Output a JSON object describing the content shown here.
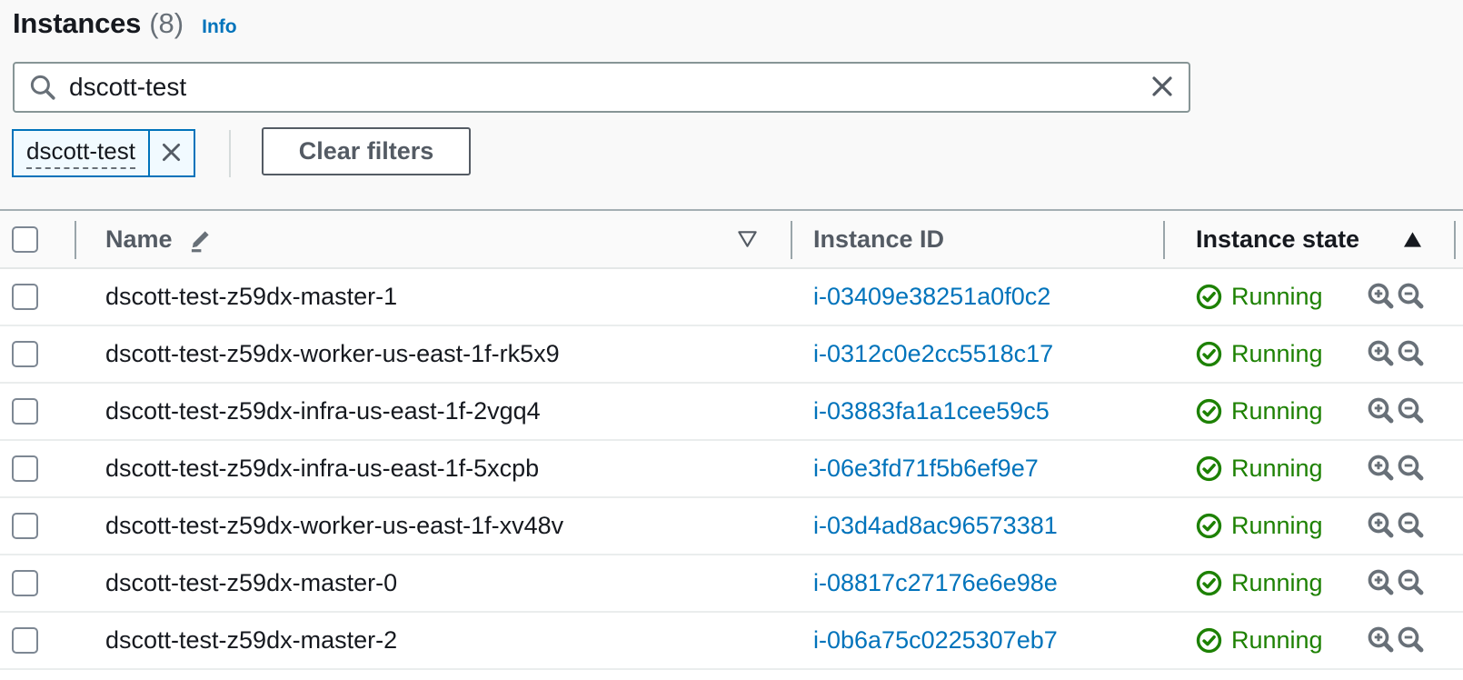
{
  "header": {
    "title": "Instances",
    "count": "(8)",
    "info_label": "Info"
  },
  "search": {
    "value": "dscott-test"
  },
  "filters": {
    "chip_label": "dscott-test",
    "clear_button_label": "Clear filters"
  },
  "table": {
    "columns": {
      "name": "Name",
      "instance_id": "Instance ID",
      "instance_state": "Instance state"
    },
    "sorted_column": "Instance state",
    "sort_direction": "ascending",
    "rows": [
      {
        "name": "dscott-test-z59dx-master-1",
        "instance_id": "i-03409e38251a0f0c2",
        "state": "Running"
      },
      {
        "name": "dscott-test-z59dx-worker-us-east-1f-rk5x9",
        "instance_id": "i-0312c0e2cc5518c17",
        "state": "Running"
      },
      {
        "name": "dscott-test-z59dx-infra-us-east-1f-2vgq4",
        "instance_id": "i-03883fa1a1cee59c5",
        "state": "Running"
      },
      {
        "name": "dscott-test-z59dx-infra-us-east-1f-5xcpb",
        "instance_id": "i-06e3fd71f5b6ef9e7",
        "state": "Running"
      },
      {
        "name": "dscott-test-z59dx-worker-us-east-1f-xv48v",
        "instance_id": "i-03d4ad8ac96573381",
        "state": "Running"
      },
      {
        "name": "dscott-test-z59dx-master-0",
        "instance_id": "i-08817c27176e6e98e",
        "state": "Running"
      },
      {
        "name": "dscott-test-z59dx-master-2",
        "instance_id": "i-0b6a75c0225307eb7",
        "state": "Running"
      }
    ]
  },
  "icons": {
    "search": "magnifier-icon",
    "status": "check-circle-icon",
    "row_zoom_in": "magnifier-plus-icon",
    "row_zoom_out": "magnifier-minus-icon",
    "name_header": "pencil-edit-icon"
  },
  "colors": {
    "link_blue": "#0073bb",
    "running_green": "#1d8102",
    "chip_background": "#f1faff",
    "chip_border": "#0073bb",
    "header_text_gray": "#545b64",
    "body_text": "#16191f"
  }
}
